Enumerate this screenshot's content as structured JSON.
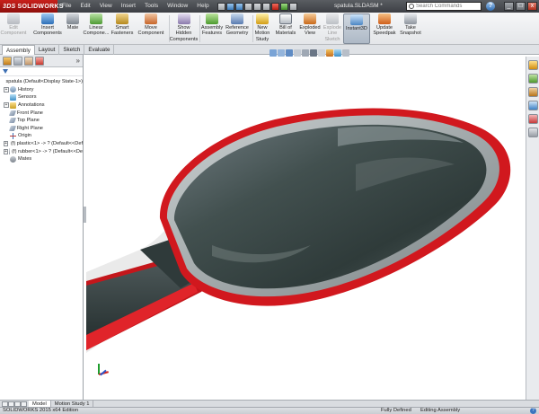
{
  "app": {
    "brand": "SOLIDWORKS",
    "brand_prefix": "3DS",
    "document_title": "spatula.SLDASM *"
  },
  "menu": [
    "File",
    "Edit",
    "View",
    "Insert",
    "Tools",
    "Window",
    "Help"
  ],
  "search": {
    "placeholder": "Search Commands"
  },
  "help_label": "?",
  "window_buttons": {
    "minimize": "_",
    "restore": "□",
    "close": "x"
  },
  "command_manager": [
    {
      "label": "Edit\nComponent",
      "disabled": true,
      "icon": "edit-component-icon"
    },
    {
      "label": "Insert\nComponents",
      "disabled": false,
      "icon": "insert-components-icon"
    },
    {
      "label": "Mate",
      "disabled": false,
      "icon": "mate-icon"
    },
    {
      "label": "Linear\nCompone...",
      "disabled": false,
      "icon": "linear-pattern-icon"
    },
    {
      "label": "Smart\nFasteners",
      "disabled": false,
      "icon": "smart-fasteners-icon"
    },
    {
      "label": "Move\nComponent",
      "disabled": false,
      "icon": "move-component-icon"
    },
    {
      "label": "Show\nHidden\nComponents",
      "disabled": false,
      "icon": "show-hidden-icon"
    },
    {
      "label": "Assembly\nFeatures",
      "disabled": false,
      "icon": "assembly-features-icon"
    },
    {
      "label": "Reference\nGeometry",
      "disabled": false,
      "icon": "reference-geometry-icon"
    },
    {
      "label": "New\nMotion\nStudy",
      "disabled": false,
      "icon": "motion-study-icon"
    },
    {
      "label": "Bill of\nMaterials",
      "disabled": false,
      "icon": "bill-of-materials-icon"
    },
    {
      "label": "Exploded\nView",
      "disabled": false,
      "icon": "exploded-view-icon"
    },
    {
      "label": "Explode\nLine\nSketch",
      "disabled": true,
      "icon": "explode-line-sketch-icon"
    },
    {
      "label": "Instant3D",
      "disabled": false,
      "icon": "instant3d-icon",
      "active": true
    },
    {
      "label": "Update\nSpeedpak",
      "disabled": false,
      "icon": "update-speedpak-icon"
    },
    {
      "label": "Take\nSnapshot",
      "disabled": false,
      "icon": "take-snapshot-icon"
    }
  ],
  "command_tabs": [
    "Assembly",
    "Layout",
    "Sketch",
    "Evaluate"
  ],
  "feature_tree": [
    {
      "label": "spatula  (Default<Display State-1>)",
      "expander": "",
      "icon": "asm",
      "indent": 0
    },
    {
      "label": "History",
      "expander": "+",
      "icon": "hist",
      "indent": 1
    },
    {
      "label": "Sensors",
      "expander": "",
      "icon": "sens",
      "indent": 1
    },
    {
      "label": "Annotations",
      "expander": "+",
      "icon": "anno",
      "indent": 1
    },
    {
      "label": "Front Plane",
      "expander": "",
      "icon": "plane",
      "indent": 1
    },
    {
      "label": "Top Plane",
      "expander": "",
      "icon": "plane",
      "indent": 1
    },
    {
      "label": "Right Plane",
      "expander": "",
      "icon": "plane",
      "indent": 1
    },
    {
      "label": "Origin",
      "expander": "",
      "icon": "origin",
      "indent": 1
    },
    {
      "label": "(f) plastic<1> -> ? (Default<<Def",
      "expander": "+",
      "icon": "part",
      "indent": 1
    },
    {
      "label": "(f) rubber<1> -> ? (Default<<De",
      "expander": "+",
      "icon": "part",
      "indent": 1
    },
    {
      "label": "Mates",
      "expander": "",
      "icon": "mates",
      "indent": 1
    }
  ],
  "panel_chevron": "»",
  "bottom_tabs": [
    "Model",
    "Motion Study 1"
  ],
  "status": {
    "edition": "SOLIDWORKS 2015 x64 Edition",
    "state": "Fully Defined",
    "mode": "Editing Assembly",
    "help": "?"
  }
}
